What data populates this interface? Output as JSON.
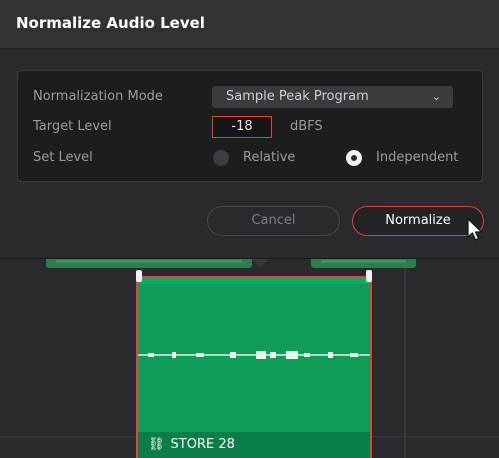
{
  "dialog": {
    "title": "Normalize Audio Level",
    "normalization_mode_label": "Normalization Mode",
    "normalization_mode_value": "Sample Peak Program",
    "target_level_label": "Target Level",
    "target_level_value": "-18",
    "target_level_unit": "dBFS",
    "set_level_label": "Set Level",
    "set_level_options": [
      {
        "label": "Relative",
        "selected": false
      },
      {
        "label": "Independent",
        "selected": true
      }
    ],
    "cancel_label": "Cancel",
    "normalize_label": "Normalize"
  },
  "timeline": {
    "clip_name": "STORE 28",
    "clip_link_glyph": "⛓"
  },
  "colors": {
    "accent_red": "#d9463b",
    "clip_green": "#0f9b58",
    "dialog_bg": "#2a2a2e"
  }
}
